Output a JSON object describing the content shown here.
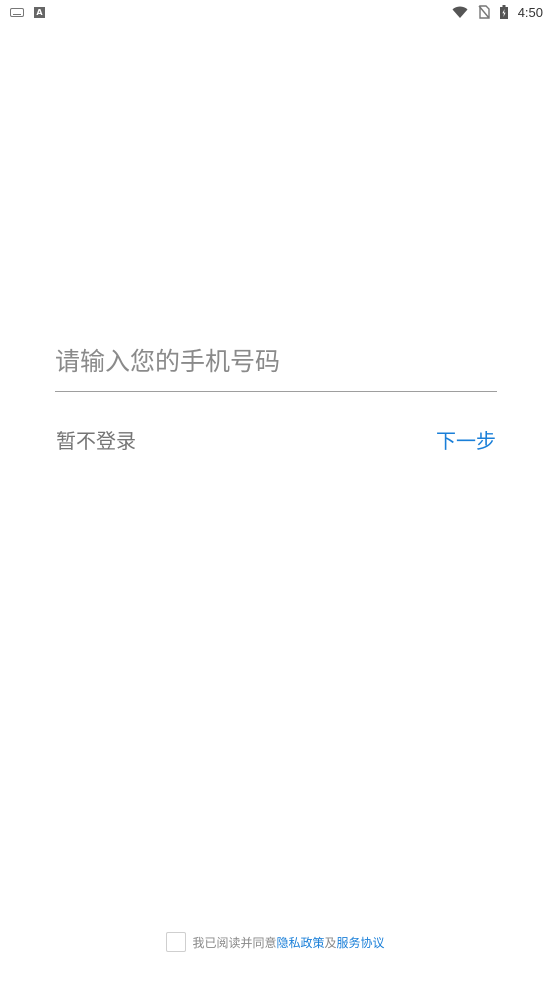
{
  "status_bar": {
    "time": "4:50",
    "icons": [
      "keyboard-icon",
      "a-app-icon",
      "wifi-icon",
      "no-sim-icon",
      "battery-icon"
    ]
  },
  "login": {
    "phone_placeholder": "请输入您的手机号码",
    "phone_value": "",
    "skip_label": "暂不登录",
    "next_label": "下一步"
  },
  "agreement": {
    "prefix": "我已阅读并同意",
    "privacy_link": "隐私政策",
    "joiner": "及",
    "service_link": "服务协议",
    "checked": false
  },
  "colors": {
    "accent": "#1a7fd8",
    "muted_text": "#757575",
    "underline": "#9e9e9e"
  }
}
